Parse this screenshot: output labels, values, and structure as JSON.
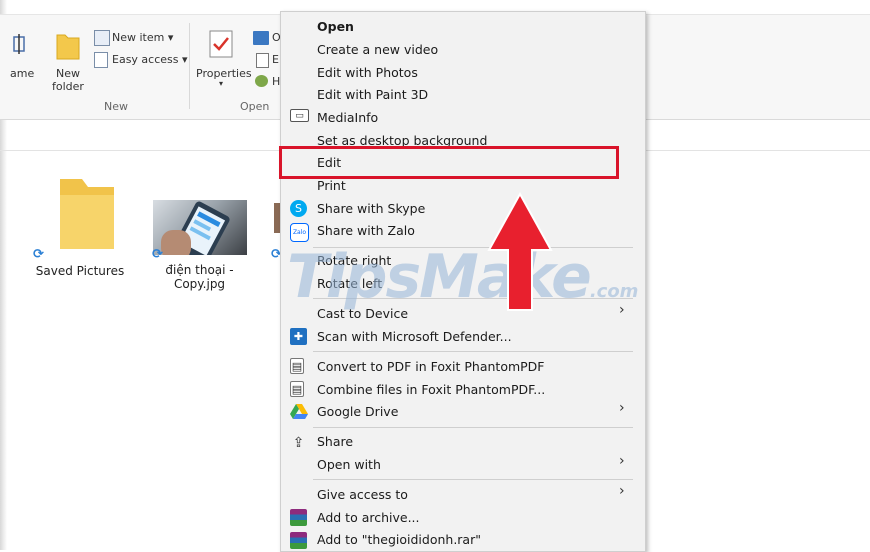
{
  "ribbon": {
    "rename_partial": "ame",
    "new_folder": [
      "New",
      "folder"
    ],
    "new_item": "New item ▾",
    "easy_access": "Easy access ▾",
    "group_new": "New",
    "properties": "Properties",
    "group_open": "Open",
    "open_partial": "O",
    "edit_partial": "E",
    "history_partial": "H"
  },
  "files": [
    {
      "name": "Saved Pictures"
    },
    {
      "name_line1": "điện thoại -",
      "name_line2": "Copy.jpg"
    }
  ],
  "context_menu": {
    "items": [
      {
        "label": "Open",
        "bold": true
      },
      {
        "label": "Create a new video"
      },
      {
        "label": "Edit with Photos"
      },
      {
        "label": "Edit with Paint 3D"
      },
      {
        "label": "MediaInfo"
      },
      {
        "label": "Set as desktop background"
      },
      {
        "label": "Edit"
      },
      {
        "label": "Print"
      },
      {
        "label": "Share with Skype"
      },
      {
        "label": "Share with Zalo"
      },
      {
        "label": "Rotate right"
      },
      {
        "label": "Rotate left"
      },
      {
        "label": "Cast to Device"
      },
      {
        "label": "Scan with Microsoft Defender..."
      },
      {
        "label": "Convert to PDF in Foxit PhantomPDF"
      },
      {
        "label": "Combine files in Foxit PhantomPDF..."
      },
      {
        "label": "Google Drive"
      },
      {
        "label": "Share"
      },
      {
        "label": "Open with"
      },
      {
        "label": "Give access to"
      },
      {
        "label": "Add to archive..."
      },
      {
        "label": "Add to \"thegioididonh.rar\""
      }
    ],
    "chevron": "›"
  },
  "watermark": {
    "main": "TipsMake",
    "suffix": ".com"
  },
  "colors": {
    "highlight": "#d9142a",
    "arrow": "#e8202e"
  }
}
